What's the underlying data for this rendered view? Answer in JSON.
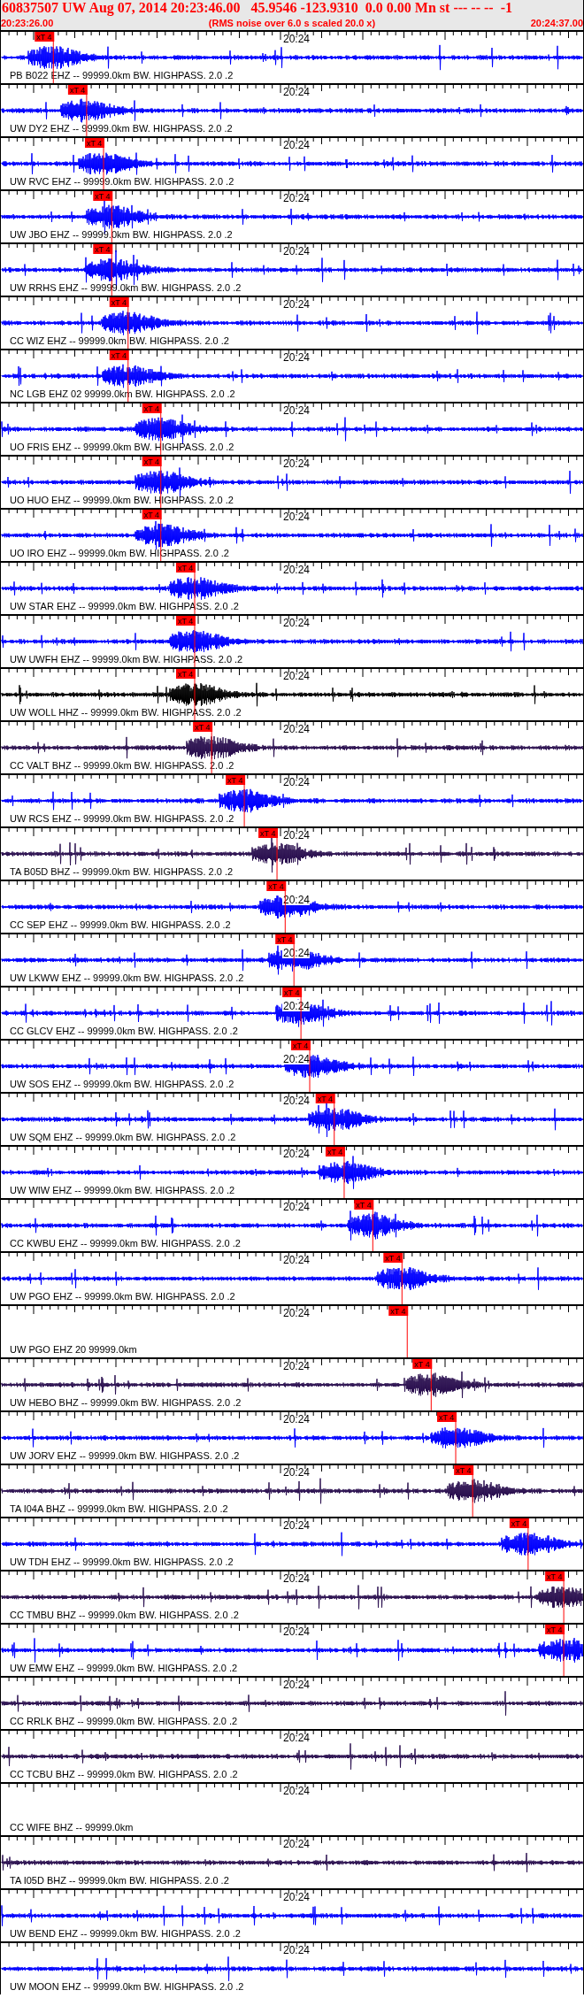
{
  "header": {
    "title": "60837507 UW Aug 07, 2014 20:23:46.00   45.9546 -123.9310  0.0 0.00 Mn st --- -- --  -1",
    "start_time": "20:23:26.00",
    "note": "(RMS noise over 6.0 s scaled 20.0 x)",
    "end_time": "20:24:37.00"
  },
  "traces": [
    {
      "label": "PB B022 EHZ -- 99999.0km BW. HIGHPASS. 2.0 .2",
      "axis_label": "20:24",
      "kind": "trace",
      "color": "#0000ff",
      "pick": {
        "label": "xT 4",
        "level": 0.058
      }
    },
    {
      "label": "UW DY2 EHZ -- 99999.0km BW. HIGHPASS. 2.0 .2",
      "axis_label": "20:24",
      "kind": "trace",
      "color": "#0000ff",
      "pick": {
        "label": "xT 4",
        "level": 0.115
      }
    },
    {
      "label": "UW RVC EHZ -- 99999.0km BW. HIGHPASS. 2.0 .2",
      "axis_label": "20:24",
      "kind": "trace",
      "color": "#0000ff",
      "pick": {
        "label": "xT 4",
        "level": 0.144
      }
    },
    {
      "label": "UW JBO EHZ -- 99999.0km BW. HIGHPASS. 2.0 .2",
      "axis_label": "20:24",
      "kind": "trace",
      "color": "#0000ff",
      "pick": {
        "label": "xT 4",
        "level": 0.158
      }
    },
    {
      "label": "UW RRHS EHZ -- 99999.0km BW. HIGHPASS. 2.0 .2",
      "axis_label": "20:24",
      "kind": "trace",
      "color": "#0000ff",
      "pick": {
        "label": "xT 4",
        "level": 0.158
      }
    },
    {
      "label": "CC WIZ EHZ -- 99999.0km BW. HIGHPASS. 2.0 .2",
      "axis_label": "20:24",
      "kind": "trace",
      "color": "#0000ff",
      "pick": {
        "label": "xT 4",
        "level": 0.186
      }
    },
    {
      "label": "NC LGB EHZ 02 99999.0km BW. HIGHPASS. 2.0 .2",
      "axis_label": "20:24",
      "kind": "trace",
      "color": "#0000ff",
      "pick": {
        "label": "xT 4",
        "level": 0.186
      }
    },
    {
      "label": "UO FRIS EHZ -- 99999.0km BW. HIGHPASS. 2.0 .2",
      "axis_label": "20:24",
      "kind": "trace",
      "color": "#0000ff",
      "pick": {
        "label": "xT 4",
        "level": 0.242
      }
    },
    {
      "label": "UO HUO EHZ -- 99999.0km BW. HIGHPASS. 2.0 .2",
      "axis_label": "20:24",
      "kind": "trace",
      "color": "#0000ff",
      "pick": {
        "label": "xT 4",
        "level": 0.242
      }
    },
    {
      "label": "UO IRO EHZ -- 99999.0km BW. HIGHPASS. 2.0 .2",
      "axis_label": "20:24",
      "kind": "trace",
      "color": "#0000ff",
      "pick": {
        "label": "xT 4",
        "level": 0.242
      }
    },
    {
      "label": "UW STAR EHZ -- 99999.0km BW. HIGHPASS. 2.0 .2",
      "axis_label": "20:24",
      "kind": "trace",
      "color": "#0000ff",
      "pick": {
        "label": "xT 4",
        "level": 0.3
      }
    },
    {
      "label": "UW UWFH EHZ -- 99999.0km BW. HIGHPASS. 2.0 .2",
      "axis_label": "20:24",
      "kind": "trace",
      "color": "#0000ff",
      "pick": {
        "label": "xT 4",
        "level": 0.3
      }
    },
    {
      "label": "UW WOLL HHZ -- 99999.0km BW. HIGHPASS. 2.0 .2",
      "axis_label": "20:24",
      "kind": "trace",
      "color": "#000000",
      "pick": {
        "label": "xT 4",
        "level": 0.3
      }
    },
    {
      "label": "CC VALT BHZ -- 99999.0km BW. HIGHPASS. 2.0 .2",
      "axis_label": "20:24",
      "kind": "trace",
      "color": "#2b1050",
      "pick": {
        "label": "xT 4",
        "level": 0.329
      }
    },
    {
      "label": "UW RCS EHZ -- 99999.0km BW. HIGHPASS. 2.0 .2",
      "axis_label": "20:24",
      "kind": "trace",
      "color": "#0000ff",
      "pick": {
        "label": "xT 4",
        "level": 0.385
      }
    },
    {
      "label": "TA B05D BHZ -- 99999.0km BW. HIGHPASS. 2.0 .2",
      "axis_label": "20:24",
      "kind": "trace",
      "color": "#2b1050",
      "pick": {
        "label": "xT 4",
        "level": 0.441
      }
    },
    {
      "label": "CC SEP EHZ -- 99999.0km BW. HIGHPASS. 2.0 .2",
      "axis_label": "20:24",
      "kind": "trace",
      "color": "#0000ff",
      "pick": {
        "label": "xT 4",
        "level": 0.455
      }
    },
    {
      "label": "UW LKWW EHZ -- 99999.0km BW. HIGHPASS. 2.0 .2",
      "axis_label": "20:24",
      "kind": "trace",
      "color": "#0000ff",
      "pick": {
        "label": "xT 4",
        "level": 0.47
      }
    },
    {
      "label": "CC GLCV EHZ -- 99999.0km BW. HIGHPASS. 2.0 .2",
      "axis_label": "20:24",
      "kind": "trace",
      "color": "#0000ff",
      "pick": {
        "label": "xT 4",
        "level": 0.482
      }
    },
    {
      "label": "UW SOS EHZ -- 99999.0km BW. HIGHPASS. 2.0 .2",
      "axis_label": "20:24",
      "kind": "trace",
      "color": "#0000ff",
      "pick": {
        "label": "xT 4",
        "level": 0.497
      }
    },
    {
      "label": "UW SQM EHZ -- 99999.0km BW. HIGHPASS. 2.0 .2",
      "axis_label": "20:24",
      "kind": "trace",
      "color": "#0000ff",
      "pick": {
        "label": "xT 4",
        "level": 0.539
      }
    },
    {
      "label": "UW WIW EHZ -- 99999.0km BW. HIGHPASS. 2.0 .2",
      "axis_label": "20:24",
      "kind": "trace",
      "color": "#0000ff",
      "pick": {
        "label": "xT 4",
        "level": 0.556
      }
    },
    {
      "label": "CC KWBU EHZ -- 99999.0km BW. HIGHPASS. 2.0 .2",
      "axis_label": "20:24",
      "kind": "trace",
      "color": "#0000ff",
      "pick": {
        "label": "xT 4",
        "level": 0.605
      }
    },
    {
      "label": "UW PGO EHZ -- 99999.0km BW. HIGHPASS. 2.0 .2",
      "axis_label": "20:24",
      "kind": "trace",
      "color": "#0000ff",
      "pick": {
        "label": "xT 4",
        "level": 0.655
      }
    },
    {
      "label": "UW PGO EHZ 20 99999.0km",
      "axis_label": "20:24",
      "kind": "empty",
      "pick": {
        "label": "xT 4",
        "level": 0.664
      }
    },
    {
      "label": "UW HEBO BHZ -- 99999.0km BW. HIGHPASS. 2.0 .2",
      "axis_label": "20:24",
      "kind": "trace",
      "color": "#2b1050",
      "pick": {
        "label": "xT 4",
        "level": 0.705
      }
    },
    {
      "label": "UW JORV EHZ -- 99999.0km BW. HIGHPASS. 2.0 .2",
      "axis_label": "20:24",
      "kind": "trace",
      "color": "#0000ff",
      "pick": {
        "label": "xT 4",
        "level": 0.747
      }
    },
    {
      "label": "TA I04A BHZ -- 99999.0km BW. HIGHPASS. 2.0 .2",
      "axis_label": "20:24",
      "kind": "trace",
      "color": "#2b1050",
      "pick": {
        "label": "xT 4",
        "level": 0.776
      }
    },
    {
      "label": "UW TDH EHZ -- 99999.0km BW. HIGHPASS. 2.0 .2",
      "axis_label": "20:24",
      "kind": "trace",
      "color": "#0000ff",
      "pick": {
        "label": "xT 4",
        "level": 0.871
      }
    },
    {
      "label": "CC TMBU BHZ -- 99999.0km BW. HIGHPASS. 2.0 .2",
      "axis_label": "20:24",
      "kind": "trace",
      "color": "#2b1050",
      "pick": {
        "label": "xT 4",
        "level": 0.932
      }
    },
    {
      "label": "UW EMW EHZ -- 99999.0km BW. HIGHPASS. 2.0 .2",
      "axis_label": "20:24",
      "kind": "trace",
      "color": "#0000ff",
      "pick": {
        "label": "xT 4",
        "level": 0.932
      }
    },
    {
      "label": "CC RRLK BHZ -- 99999.0km BW. HIGHPASS. 2.0 .2",
      "axis_label": "20:24",
      "kind": "trace",
      "color": "#2b1050"
    },
    {
      "label": "CC TCBU BHZ -- 99999.0km BW. HIGHPASS. 2.0 .2",
      "axis_label": "20:24",
      "kind": "trace",
      "color": "#2b1050"
    },
    {
      "label": "CC WIFE BHZ -- 99999.0km",
      "axis_label": "20:24",
      "kind": "empty"
    },
    {
      "label": "TA I05D BHZ -- 99999.0km BW. HIGHPASS. 2.0 .2",
      "axis_label": "20:24",
      "kind": "trace",
      "color": "#2b1050"
    },
    {
      "label": "UW BEND EHZ -- 99999.0km BW. HIGHPASS. 2.0 .2",
      "axis_label": "20:24",
      "kind": "trace",
      "color": "#0000ff"
    },
    {
      "label": "UW MOON EHZ -- 99999.0km BW. HIGHPASS. 2.0 .2",
      "axis_label": "20:24",
      "kind": "trace",
      "color": "#0000ff"
    }
  ]
}
